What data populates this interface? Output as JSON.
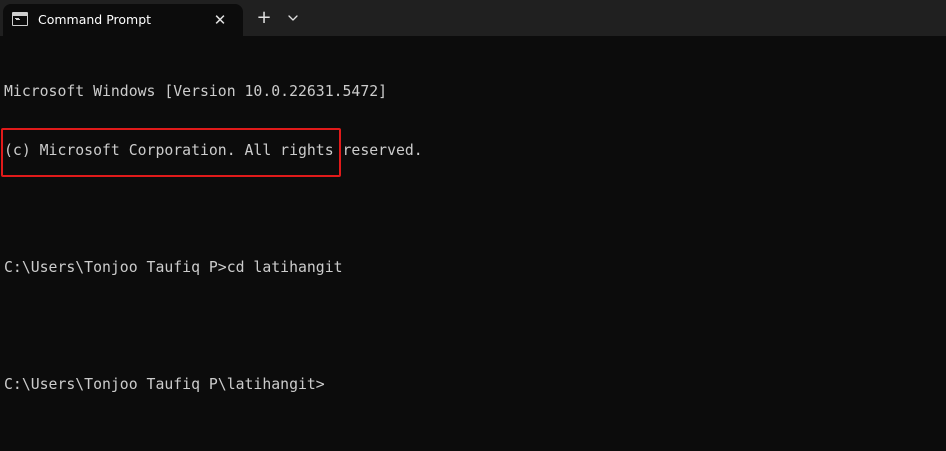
{
  "window": {
    "tab_title": "Command Prompt",
    "tab_icon": "terminal-icon",
    "close_icon": "close-icon",
    "new_tab_icon": "plus-icon",
    "dropdown_icon": "chevron-down-icon",
    "close_glyph": "✕",
    "new_tab_glyph": "+"
  },
  "terminal": {
    "lines": [
      "Microsoft Windows [Version 10.0.22631.5472]",
      "(c) Microsoft Corporation. All rights reserved.",
      "",
      "C:\\Users\\Tonjoo Taufiq P>cd latihangit",
      "",
      "C:\\Users\\Tonjoo Taufiq P\\latihangit>"
    ]
  },
  "colors": {
    "background": "#0c0c0c",
    "titlebar": "#202020",
    "text": "#cccccc",
    "highlight": "#e11a1a"
  }
}
